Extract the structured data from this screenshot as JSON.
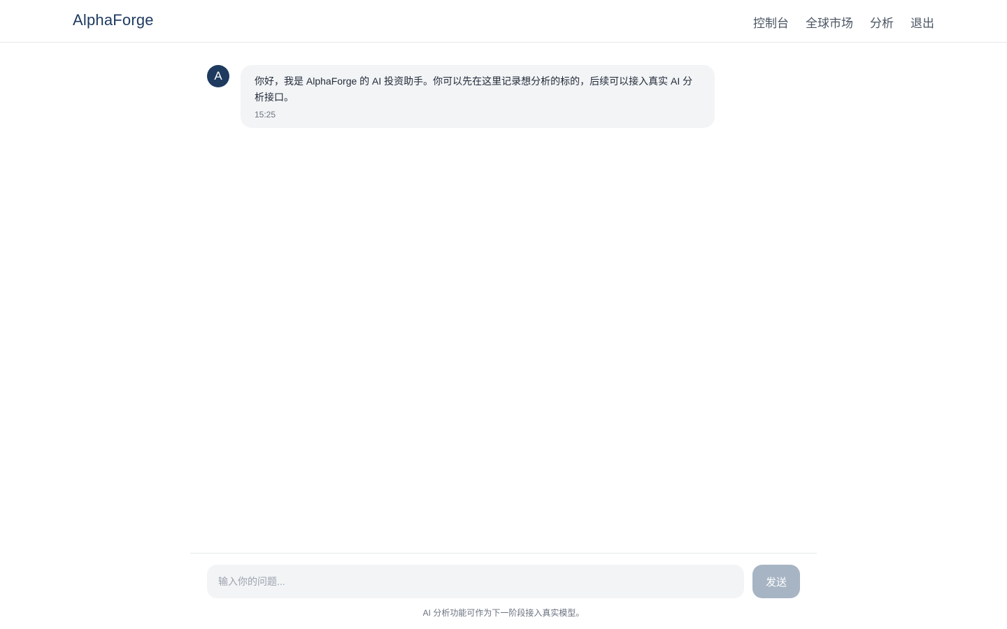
{
  "header": {
    "brand": "AlphaForge",
    "nav": [
      "控制台",
      "全球市场",
      "分析",
      "退出"
    ]
  },
  "chat": {
    "messages": [
      {
        "avatar": "A",
        "text": "你好，我是 AlphaForge 的 AI 投资助手。你可以先在这里记录想分析的标的，后续可以接入真实 AI 分析接口。",
        "time": "15:25"
      }
    ]
  },
  "composer": {
    "placeholder": "输入你的问题...",
    "send_label": "发送",
    "footnote": "AI 分析功能可作为下一阶段接入真实模型。"
  },
  "colors": {
    "brand": "#1e3a5f",
    "send_disabled": "#a7b4c4",
    "bubble_bg": "#f3f4f6"
  }
}
